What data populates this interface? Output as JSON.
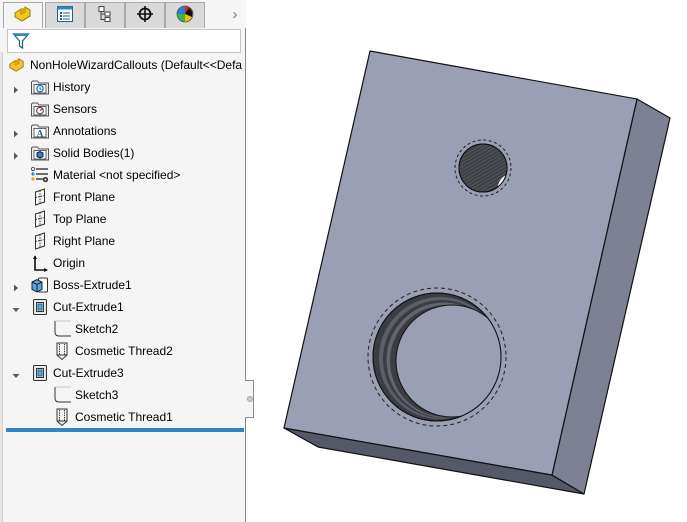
{
  "tabs": [
    {
      "name": "featuremanager",
      "icon": "part-icon",
      "active": true
    },
    {
      "name": "propertymanager",
      "icon": "property-list-icon",
      "active": false
    },
    {
      "name": "configurationmanager",
      "icon": "configuration-tree-icon",
      "active": false
    },
    {
      "name": "dimxpertmanager",
      "icon": "crosshair-icon",
      "active": false
    },
    {
      "name": "displaymanager",
      "icon": "appearance-sphere-icon",
      "active": false
    }
  ],
  "tab_overflow": "›",
  "filter": {
    "icon": "filter-funnel-icon",
    "value": ""
  },
  "tree": {
    "root": {
      "label": "NonHoleWizardCallouts  (Default<<Defa",
      "icon": "part-icon"
    },
    "items": [
      {
        "label": "History",
        "icon": "history-folder-icon",
        "expander": "collapsed",
        "level": 0
      },
      {
        "label": "Sensors",
        "icon": "sensors-folder-icon",
        "expander": "none",
        "level": 0
      },
      {
        "label": "Annotations",
        "icon": "annotations-folder-icon",
        "expander": "collapsed",
        "level": 0
      },
      {
        "label": "Solid Bodies(1)",
        "icon": "solid-bodies-folder-icon",
        "expander": "collapsed",
        "level": 0
      },
      {
        "label": "Material <not specified>",
        "icon": "material-icon",
        "expander": "none",
        "level": 0
      },
      {
        "label": "Front Plane",
        "icon": "plane-icon",
        "expander": "none",
        "level": 0
      },
      {
        "label": "Top Plane",
        "icon": "plane-icon",
        "expander": "none",
        "level": 0
      },
      {
        "label": "Right Plane",
        "icon": "plane-icon",
        "expander": "none",
        "level": 0
      },
      {
        "label": "Origin",
        "icon": "origin-icon",
        "expander": "none",
        "level": 0
      },
      {
        "label": "Boss-Extrude1",
        "icon": "boss-extrude-icon",
        "expander": "collapsed",
        "level": 0
      },
      {
        "label": "Cut-Extrude1",
        "icon": "cut-extrude-icon",
        "expander": "expanded",
        "level": 0
      },
      {
        "label": "Sketch2",
        "icon": "sketch-icon",
        "expander": "none",
        "level": 1
      },
      {
        "label": "Cosmetic Thread2",
        "icon": "cosmetic-thread-icon",
        "expander": "none",
        "level": 1
      },
      {
        "label": "Cut-Extrude3",
        "icon": "cut-extrude-icon",
        "expander": "expanded",
        "level": 0
      },
      {
        "label": "Sketch3",
        "icon": "sketch-icon",
        "expander": "none",
        "level": 1
      },
      {
        "label": "Cosmetic Thread1",
        "icon": "cosmetic-thread-icon",
        "expander": "none",
        "level": 1
      }
    ]
  },
  "colors": {
    "front_face": "#9a9fb3",
    "right_face": "#7e8194",
    "bottom_face": "#555866",
    "hole_dark": "#3a3b40",
    "rollback_bar": "#2f86c2"
  }
}
